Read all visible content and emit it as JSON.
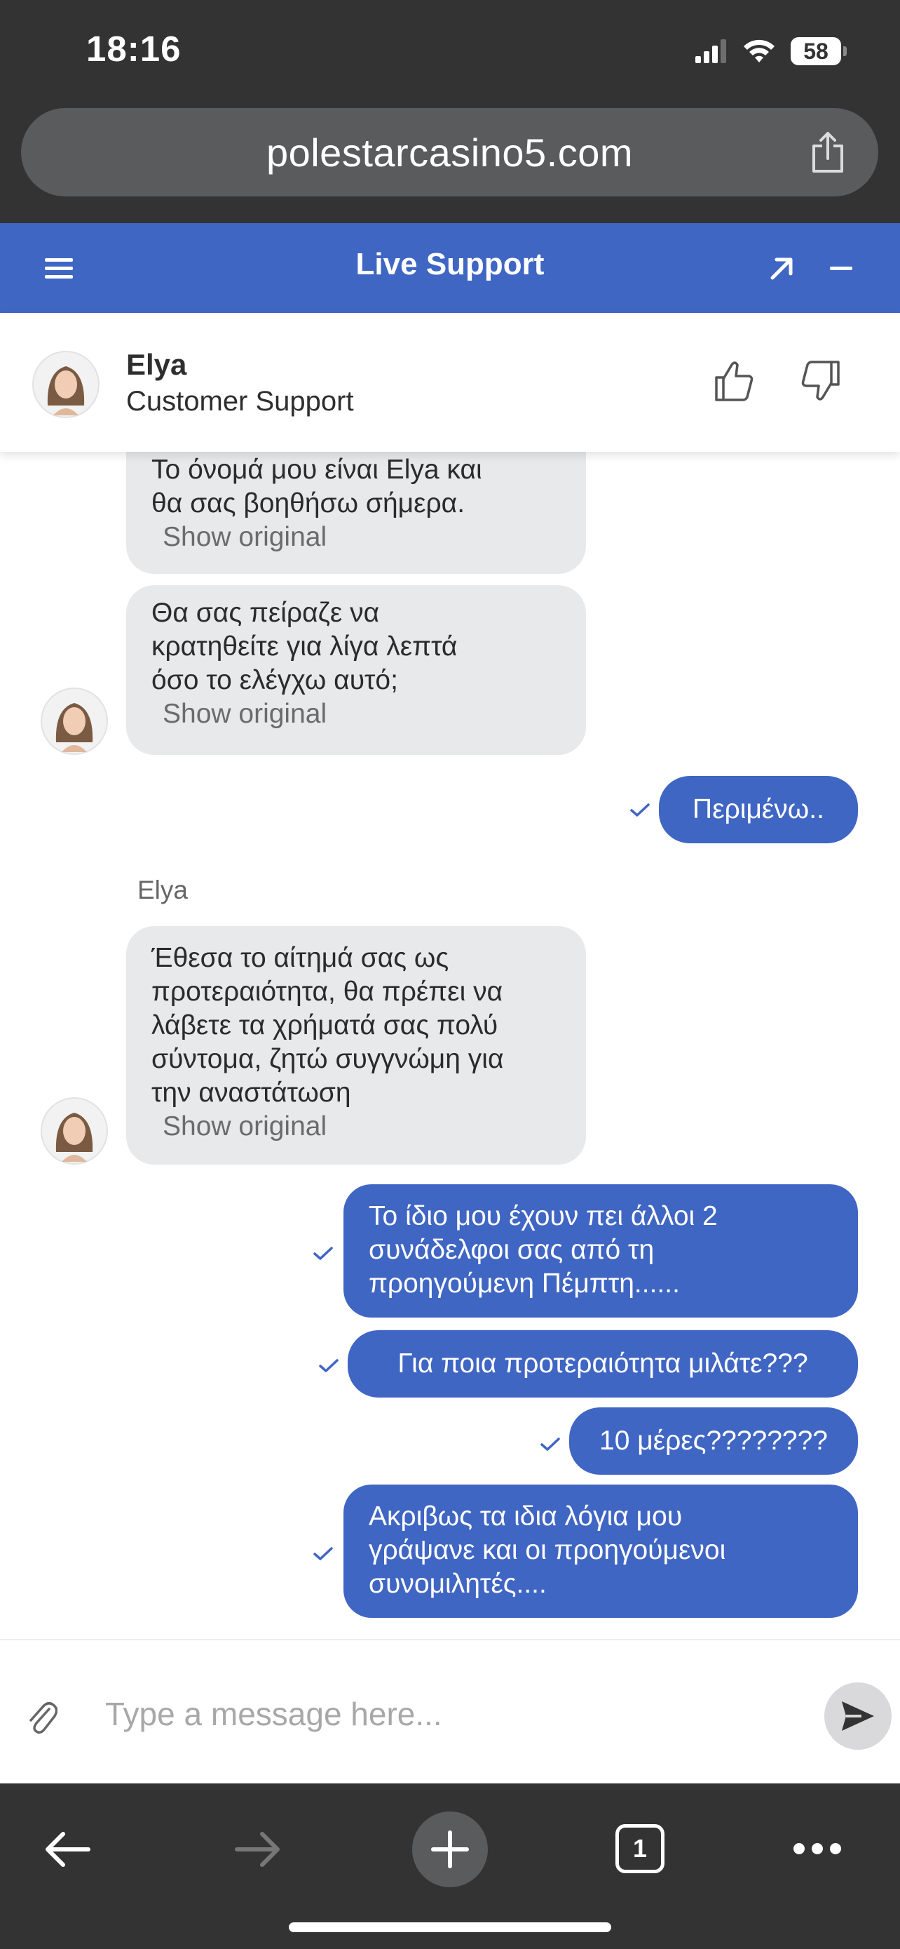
{
  "status_bar": {
    "time": "18:16",
    "battery": "58"
  },
  "browser": {
    "url": "polestarcasino5.com",
    "tab_count": "1"
  },
  "widget": {
    "title": "Live Support"
  },
  "agent": {
    "name": "Elya",
    "role": "Customer Support"
  },
  "messages": {
    "m1": {
      "lines": [
        "Το όνομά μου είναι Elya και",
        "θα σας βοηθήσω σήμερα."
      ],
      "show_original": "Show original"
    },
    "m2": {
      "lines": [
        "Θα σας πείραζε να",
        "κρατηθείτε για λίγα λεπτά",
        "όσο το ελέγχω αυτό;"
      ],
      "show_original": "Show original"
    },
    "m3": {
      "text": "Περιμένω.."
    },
    "sender": "Elya",
    "m4": {
      "lines": [
        "Έθεσα το αίτημά σας ως",
        "προτεραιότητα, θα πρέπει να",
        "λάβετε τα χρήματά σας πολύ",
        "σύντομα, ζητώ συγγνώμη για",
        "την αναστάτωση"
      ],
      "show_original": "Show original"
    },
    "m5": {
      "lines": [
        "Το ίδιο μου έχουν πει άλλοι 2",
        "συνάδελφοι σας από τη",
        "προηγούμενη Πέμπτη......"
      ]
    },
    "m6": {
      "text": "Για ποια προτεραιότητα μιλάτε???"
    },
    "m7": {
      "text": "10 μέρες????????"
    },
    "m8": {
      "lines": [
        "Ακριβως τα ιδια λόγια μου",
        "γράψανε και οι προηγούμενοι",
        "συνομιλητές...."
      ]
    }
  },
  "composer": {
    "placeholder": "Type a message here..."
  },
  "colors": {
    "accent": "#4066c4",
    "incoming_bubble": "#e8e9eb",
    "chrome": "#333334"
  },
  "icons": {
    "menu": "hamburger-icon",
    "expand": "arrow-up-right-icon",
    "minimize": "minus-icon",
    "like": "thumbs-up-icon",
    "dislike": "thumbs-down-icon",
    "attach": "paperclip-icon",
    "send": "send-icon",
    "share": "share-icon",
    "back": "arrow-left-icon",
    "forward": "arrow-right-icon",
    "new_tab": "plus-icon",
    "more": "ellipsis-icon",
    "delivered": "check-icon"
  }
}
